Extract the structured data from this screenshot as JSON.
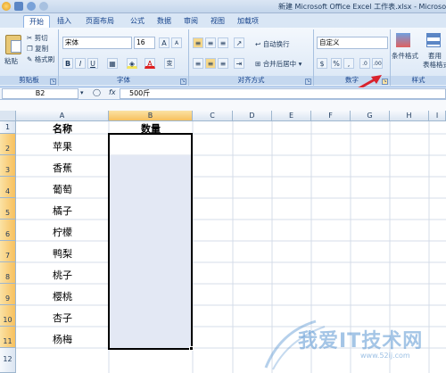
{
  "window": {
    "title": "新建 Microsoft Office Excel 工作表.xlsx - Microsoft Exc"
  },
  "tabs": [
    "开始",
    "插入",
    "页面布局",
    "公式",
    "数据",
    "审阅",
    "视图",
    "加载项"
  ],
  "clipboard": {
    "paste": "粘贴",
    "cut": "剪切",
    "copy": "复制",
    "format_painter": "格式刷",
    "label": "剪贴板"
  },
  "font": {
    "name": "宋体",
    "size": "16",
    "bold": "B",
    "italic": "I",
    "underline": "U",
    "label": "字体",
    "grow": "A",
    "shrink": "A",
    "wen": "变"
  },
  "alignment": {
    "wrap": "自动换行",
    "merge": "合并后居中",
    "label": "对齐方式"
  },
  "number": {
    "format": "自定义",
    "percent": "%",
    "comma": ",",
    "label": "数字"
  },
  "styles": {
    "conditional": "条件格式",
    "table": "套用",
    "table2": "表格格式",
    "label": "样式"
  },
  "formula_bar": {
    "namebox": "B2",
    "fx": "fx",
    "content": "500斤"
  },
  "columns": [
    "A",
    "B",
    "C",
    "D",
    "E",
    "F",
    "G",
    "H",
    "I"
  ],
  "rows": [
    "1",
    "2",
    "3",
    "4",
    "5",
    "6",
    "7",
    "8",
    "9",
    "10",
    "11",
    "12"
  ],
  "cells": {
    "a1": "名称",
    "b1": "数量",
    "fruits": [
      "苹果",
      "香蕉",
      "葡萄",
      "橘子",
      "柠檬",
      "鸭梨",
      "桃子",
      "樱桃",
      "杏子",
      "杨梅"
    ]
  },
  "watermark": {
    "text": "我爱IT技术网",
    "url": "www.52ij.com"
  },
  "colors": {
    "selection": "#e3e8f4",
    "accent": "#f7c05e",
    "arrow": "#d9232d"
  }
}
